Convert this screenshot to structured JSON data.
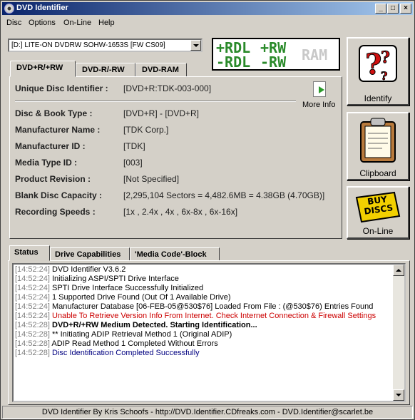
{
  "window": {
    "title": "DVD Identifier"
  },
  "titlebar_buttons": {
    "minimize": "_",
    "maximize": "□",
    "close": "×"
  },
  "menu": {
    "items": [
      "Disc",
      "Options",
      "On-Line",
      "Help"
    ]
  },
  "drive": {
    "selected": "[D:] LITE-ON DVDRW SOHW-1653S [FW CS09]"
  },
  "logo": {
    "w1": "+RDL",
    "w2": "-RDL",
    "w3": "+RW",
    "w4": "-RW",
    "w5": "RAM",
    "colors": {
      "green": "#2a8a2a",
      "gray": "#c8c8c8"
    }
  },
  "tabs": [
    "DVD+R/+RW",
    "DVD-R/-RW",
    "DVD-RAM"
  ],
  "active_tab": "DVD+R/+RW",
  "disc_info": {
    "uid_label": "Unique Disc Identifier :",
    "uid_value": "[DVD+R:TDK-003-000]",
    "rows": [
      {
        "label": "Disc & Book Type :",
        "value": "[DVD+R] - [DVD+R]"
      },
      {
        "label": "Manufacturer Name :",
        "value": "[TDK Corp.]"
      },
      {
        "label": "Manufacturer ID :",
        "value": "[TDK]"
      },
      {
        "label": "Media Type ID :",
        "value": "[003]"
      },
      {
        "label": "Product Revision :",
        "value": "[Not Specified]"
      },
      {
        "label": "Blank Disc Capacity :",
        "value": "[2,295,104 Sectors = 4,482.6MB = 4.38GB (4.70GB)]"
      },
      {
        "label": "Recording Speeds :",
        "value": "[1x , 2.4x , 4x , 6x-8x , 6x-16x]"
      }
    ],
    "more_info": "More Info"
  },
  "side_buttons": {
    "identify": "Identify",
    "clipboard": "Clipboard",
    "online": "On-Line",
    "buy_discs": "BUY DISCS"
  },
  "bottom_tabs": [
    "Status",
    "Drive Capabilities",
    "'Media Code'-Block"
  ],
  "log": [
    {
      "time": "[14:52:24]",
      "text": "DVD Identifier V3.6.2",
      "style": "normal"
    },
    {
      "time": "[14:52:24]",
      "text": "Initializing ASPI/SPTI Drive Interface",
      "style": "normal"
    },
    {
      "time": "[14:52:24]",
      "text": "SPTI Drive Interface Successfully Initialized",
      "style": "normal"
    },
    {
      "time": "[14:52:24]",
      "text": "1 Supported Drive Found (Out Of 1 Available Drive)",
      "style": "normal"
    },
    {
      "time": "[14:52:24]",
      "text": "Manufacturer Database [06-FEB-05@530$76] Loaded From File : (@530$76) Entries Found",
      "style": "normal"
    },
    {
      "time": "[14:52:24]",
      "text": "Unable To Retrieve Version Info From Internet. Check Internet Connection & Firewall Settings",
      "style": "error"
    },
    {
      "time": "[14:52:28]",
      "text": "DVD+R/+RW Medium Detected. Starting Identification...",
      "style": "bold"
    },
    {
      "time": "[14:52:28]",
      "text": "** Initiating ADIP Retrieval Method 1 (Original ADIP)",
      "style": "normal"
    },
    {
      "time": "[14:52:28]",
      "text": "ADIP Read Method 1 Completed Without Errors",
      "style": "normal"
    },
    {
      "time": "[14:52:28]",
      "text": "Disc Identification Completed Successfully",
      "style": "success"
    }
  ],
  "log_colors": {
    "error": "#cc0000",
    "success": "#000080",
    "normal": "#000000"
  },
  "statusbar": {
    "text": "DVD Identifier By Kris Schoofs  -  http://DVD.Identifier.CDfreaks.com  -  DVD.Identifier@scarlet.be"
  }
}
